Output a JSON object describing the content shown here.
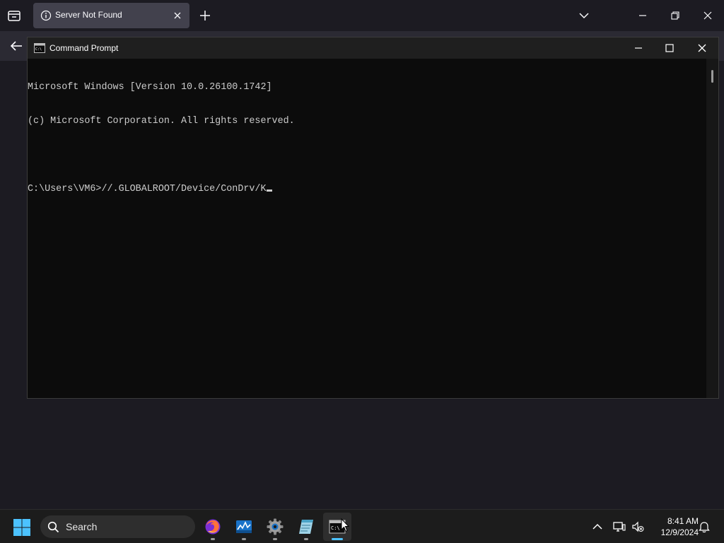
{
  "browser": {
    "tab_title": "Server Not Found"
  },
  "cmd": {
    "title": "Command Prompt",
    "lines": [
      "Microsoft Windows [Version 10.0.26100.1742]",
      "(c) Microsoft Corporation. All rights reserved.",
      "",
      "C:\\Users\\VM6>//.GLOBALROOT/Device/ConDrv/K"
    ]
  },
  "taskbar": {
    "search_label": "Search",
    "time": "8:41 AM",
    "date": "12/9/2024",
    "apps": [
      "firefox-icon",
      "task-manager-icon",
      "settings-icon",
      "notepad-icon",
      "command-prompt-icon"
    ]
  },
  "colors": {
    "console_bg": "#0c0c0c",
    "console_text": "#cccccc",
    "tab_bg": "#42414d",
    "active_indicator": "#4cc2ff"
  }
}
